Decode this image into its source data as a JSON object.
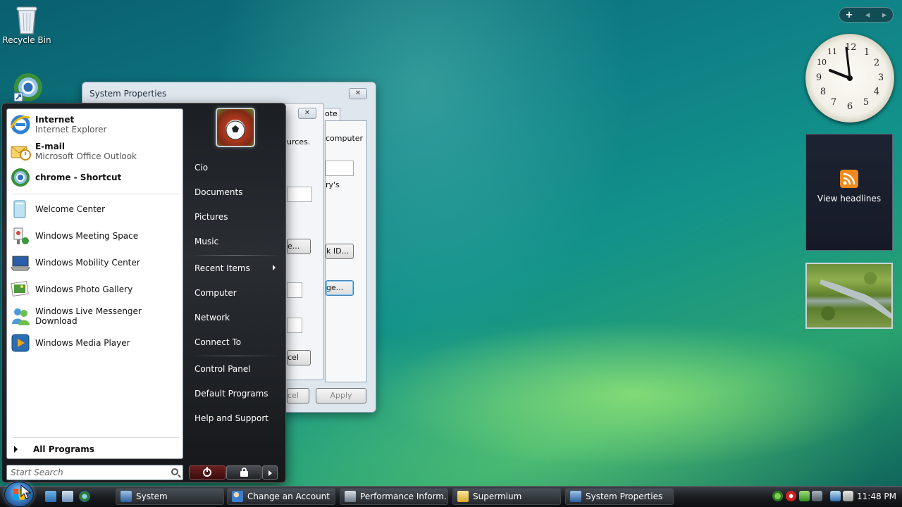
{
  "desktop": {
    "icons": [
      {
        "label": "Recycle Bin"
      }
    ]
  },
  "sidebar": {
    "controls": {
      "add": "+",
      "prev": "◂",
      "next": "▸"
    },
    "clock_numbers": [
      "12",
      "1",
      "2",
      "3",
      "4",
      "5",
      "6",
      "7",
      "8",
      "9",
      "10",
      "11"
    ],
    "feed_label": "View headlines"
  },
  "dialog": {
    "title": "System Properties",
    "close": "✕",
    "tab_fragment": "note",
    "fragments": [
      "computer",
      "urces.",
      "ry's"
    ],
    "buttons": {
      "frag1": "e...",
      "frag2": "k ID...",
      "frag3": "ge...",
      "frag4": "cel",
      "frag5": "cel",
      "apply": "Apply"
    }
  },
  "start_menu": {
    "pinned": [
      {
        "title": "Internet",
        "subtitle": "Internet Explorer"
      },
      {
        "title": "E-mail",
        "subtitle": "Microsoft Office Outlook"
      },
      {
        "title": "chrome - Shortcut"
      }
    ],
    "recent": [
      "Welcome Center",
      "Windows Meeting Space",
      "Windows Mobility Center",
      "Windows Photo Gallery",
      "Windows Live Messenger Download",
      "Windows Media Player"
    ],
    "all_programs": "All Programs",
    "search_placeholder": "Start Search",
    "right": {
      "user": "Cio",
      "documents": "Documents",
      "pictures": "Pictures",
      "music": "Music",
      "recent_items": "Recent Items",
      "computer": "Computer",
      "network": "Network",
      "connect_to": "Connect To",
      "control_panel": "Control Panel",
      "default_programs": "Default Programs",
      "help": "Help and Support"
    }
  },
  "taskbar": {
    "tasks": [
      "System",
      "Change an Account",
      "Performance Inform...",
      "Supermium",
      "System Properties"
    ],
    "time": "11:48 PM"
  }
}
